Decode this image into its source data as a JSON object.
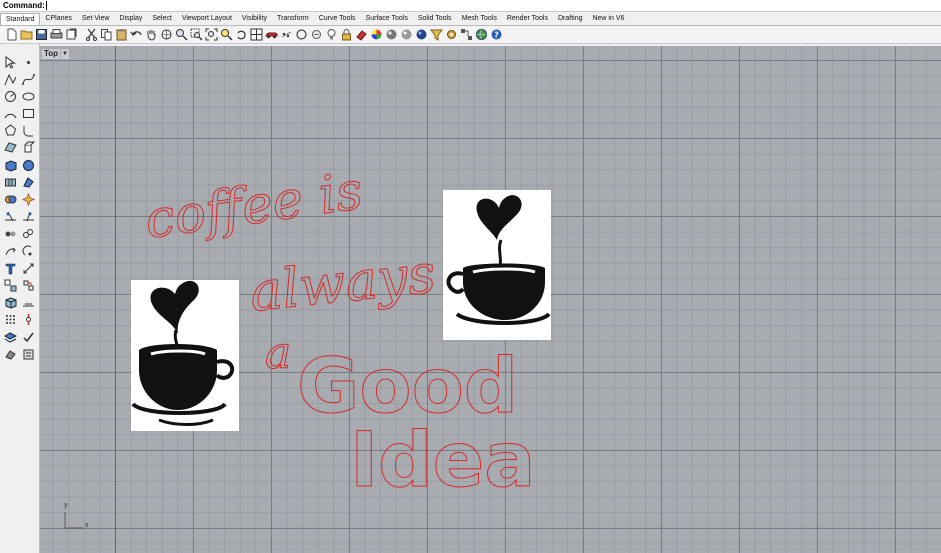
{
  "command": {
    "label": "Command:",
    "value": ""
  },
  "tabs": [
    "Standard",
    "CPlanes",
    "Set View",
    "Display",
    "Select",
    "Viewport Layout",
    "Visibility",
    "Transform",
    "Curve Tools",
    "Surface Tools",
    "Solid Tools",
    "Mesh Tools",
    "Render Tools",
    "Drafting",
    "New in V6"
  ],
  "active_tab": "Standard",
  "viewport": {
    "name": "Top"
  },
  "artwork": {
    "line1": "coffee is",
    "line2": "always",
    "line3": "a",
    "line4": "Good",
    "line5": "Idea"
  },
  "axes": {
    "x": "x",
    "y": "y"
  },
  "colors": {
    "curve": "#d42a2a",
    "grid": "#a8acb1",
    "y_axis": "#2b8a2b"
  }
}
